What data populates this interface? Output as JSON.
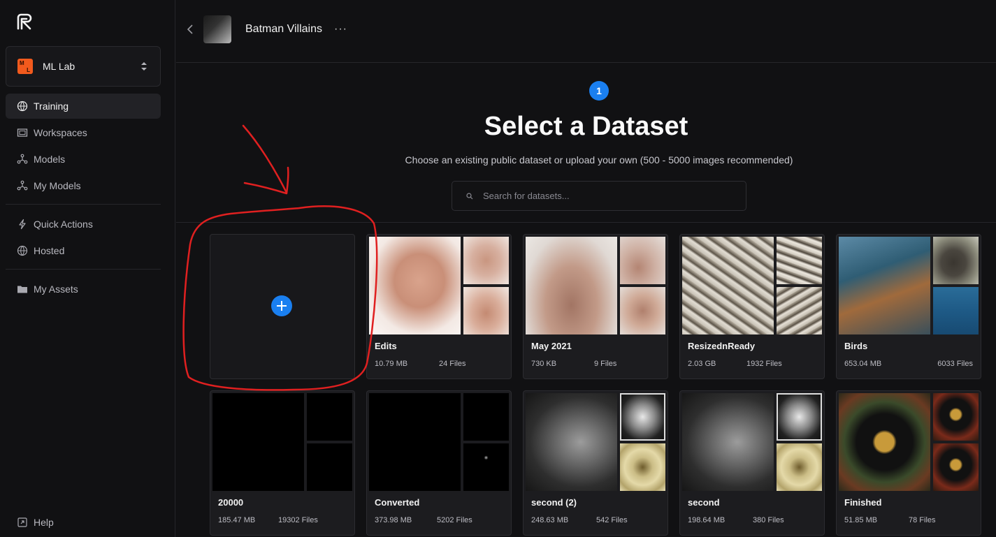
{
  "sidebar": {
    "logo_icon": "runway-logo-icon",
    "workspace": {
      "badge_top": "M",
      "badge_bottom": "L",
      "name": "ML Lab",
      "accent": "#f25a1d"
    },
    "nav_primary": [
      {
        "label": "Training",
        "icon": "training-icon",
        "active": true
      },
      {
        "label": "Workspaces",
        "icon": "workspaces-icon"
      },
      {
        "label": "Models",
        "icon": "models-icon"
      },
      {
        "label": "My Models",
        "icon": "my-models-icon"
      }
    ],
    "nav_secondary": [
      {
        "label": "Quick Actions",
        "icon": "lightning-icon"
      },
      {
        "label": "Hosted",
        "icon": "globe-icon"
      }
    ],
    "nav_tertiary": [
      {
        "label": "My Assets",
        "icon": "folder-icon"
      }
    ],
    "help": {
      "label": "Help",
      "icon": "help-icon"
    }
  },
  "header": {
    "project_title": "Batman Villains",
    "more_label": "···"
  },
  "main": {
    "step_number": "1",
    "title": "Select a Dataset",
    "subtitle": "Choose an existing public dataset or upload your own (500 - 5000 images recommended)",
    "search_placeholder": "Search for datasets...",
    "accent": "#1a7ff0"
  },
  "datasets": [
    {
      "name": "Edits",
      "size": "10.79 MB",
      "files": "24 Files"
    },
    {
      "name": "May 2021",
      "size": "730 KB",
      "files": "9 Files"
    },
    {
      "name": "ResizednReady",
      "size": "2.03 GB",
      "files": "1932 Files"
    },
    {
      "name": "Birds",
      "size": "653.04 MB",
      "files": "6033 Files"
    },
    {
      "name": "20000",
      "size": "185.47 MB",
      "files": "19302 Files"
    },
    {
      "name": "Converted",
      "size": "373.98 MB",
      "files": "5202 Files"
    },
    {
      "name": "second (2)",
      "size": "248.63 MB",
      "files": "542 Files"
    },
    {
      "name": "second",
      "size": "198.64 MB",
      "files": "380 Files"
    },
    {
      "name": "Finished",
      "size": "51.85 MB",
      "files": "78 Files"
    }
  ],
  "annotation": {
    "color": "#e02020",
    "shapes": [
      "arrow",
      "circle"
    ]
  }
}
